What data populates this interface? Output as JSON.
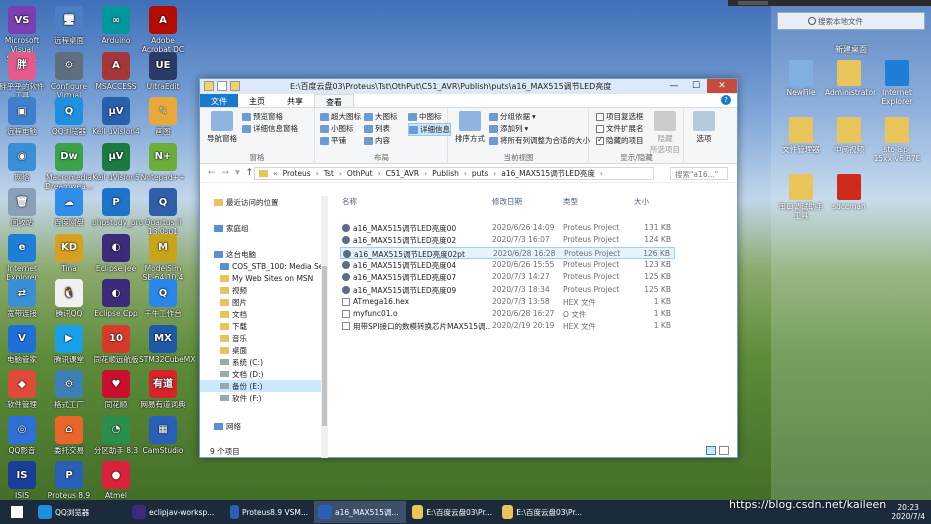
{
  "desktop_icons": [
    {
      "label": "Microsoft Visual Studio...",
      "color": "#7a3fb0",
      "glyph": "VS"
    },
    {
      "label": "远程桌面",
      "color": "#4c7fc4",
      "glyph": "🖥"
    },
    {
      "label": "Arduino",
      "color": "#00979d",
      "glyph": "∞"
    },
    {
      "label": "Adobe Acrobat DC",
      "color": "#b30b00",
      "glyph": "A"
    },
    {
      "label": "胖乎乎的软件工具",
      "color": "#e15b8c",
      "glyph": "胖"
    },
    {
      "label": "Configure Virtual Serial...",
      "color": "#5f6f80",
      "glyph": "⚙"
    },
    {
      "label": "MSACCESS",
      "color": "#a4373a",
      "glyph": "A"
    },
    {
      "label": "UltraEdit",
      "color": "#2b3a67",
      "glyph": "UE"
    },
    {
      "label": "远程电脑",
      "color": "#3f7fcf",
      "glyph": "▣"
    },
    {
      "label": "QQ浏览器",
      "color": "#1f8fe0",
      "glyph": "Q"
    },
    {
      "label": "Keil uVision4",
      "color": "#2a5fb0",
      "glyph": "µV"
    },
    {
      "label": "画图",
      "color": "#e9a93a",
      "glyph": "✎"
    },
    {
      "label": "网络",
      "color": "#3a8fd6",
      "glyph": "◉"
    },
    {
      "label": "Macromedia Dreamwea...",
      "color": "#3aa34a",
      "glyph": "Dw"
    },
    {
      "label": "Keil uVision5",
      "color": "#1a7a3f",
      "glyph": "µV"
    },
    {
      "label": "Notepad++",
      "color": "#6cae3a",
      "glyph": "N+"
    },
    {
      "label": "回收站",
      "color": "#8aa0b8",
      "glyph": "🗑"
    },
    {
      "label": "百度网盘",
      "color": "#2f8fe8",
      "glyph": "☁"
    },
    {
      "label": "phpstudy_pro",
      "color": "#1e72c8",
      "glyph": "P"
    },
    {
      "label": "Quartus II 13.0sp1 (64-...",
      "color": "#2f5fa8",
      "glyph": "Q"
    },
    {
      "label": "Internet Explorer",
      "color": "#1d7fd6",
      "glyph": "e"
    },
    {
      "label": "Tina",
      "color": "#d8a020",
      "glyph": "KD"
    },
    {
      "label": "Eclipse Jee",
      "color": "#3b2b7a",
      "glyph": "◐"
    },
    {
      "label": "ModelSim SE-64 10.4",
      "color": "#c7a41a",
      "glyph": "M"
    },
    {
      "label": "宽带连接",
      "color": "#3a8fd6",
      "glyph": "⇄"
    },
    {
      "label": "腾讯QQ",
      "color": "#f0f0f0",
      "glyph": "🐧"
    },
    {
      "label": "Eclipse Cpp",
      "color": "#3b2b7a",
      "glyph": "◐"
    },
    {
      "label": "千牛工作台",
      "color": "#2a86e8",
      "glyph": "Q"
    },
    {
      "label": "电脑管家",
      "color": "#1e6fd8",
      "glyph": "V"
    },
    {
      "label": "腾讯课堂",
      "color": "#19a0e8",
      "glyph": "▶"
    },
    {
      "label": "同花顺远航版",
      "color": "#d83a2a",
      "glyph": "10"
    },
    {
      "label": "STM32CubeMX",
      "color": "#1f5aa8",
      "glyph": "MX"
    },
    {
      "label": "软件管理",
      "color": "#e04a3a",
      "glyph": "◆"
    },
    {
      "label": "格式工厂",
      "color": "#3f7fb8",
      "glyph": "⚙"
    },
    {
      "label": "同花顺",
      "color": "#c8102e",
      "glyph": "♥"
    },
    {
      "label": "网易有道词典",
      "color": "#d8232a",
      "glyph": "有道"
    },
    {
      "label": "QQ影音",
      "color": "#2f6fd8",
      "glyph": "◎"
    },
    {
      "label": "委托交易",
      "color": "#e8662a",
      "glyph": "⌂"
    },
    {
      "label": "分区助手 8.3",
      "color": "#2a8f4a",
      "glyph": "◔"
    },
    {
      "label": "CamStudio",
      "color": "#2a5fb8",
      "glyph": "▦"
    },
    {
      "label": "ISIS",
      "color": "#1a3f9a",
      "glyph": "IS"
    },
    {
      "label": "Proteus 8.9 Professional",
      "color": "#2a5fb8",
      "glyph": "P"
    },
    {
      "label": "Atmel Studio 7.0",
      "color": "#d8233a",
      "glyph": "●"
    }
  ],
  "right_panel": {
    "search_placeholder": "搜索本地文件",
    "title": "新建桌面",
    "icons": [
      {
        "label": "NewFile",
        "color": "#7fb0e0"
      },
      {
        "label": "Administrator",
        "color": "#e9c45a"
      },
      {
        "label": "Internet Explorer",
        "color": "#1d7fd6"
      },
      {
        "label": "文件管理器",
        "color": "#e9c45a"
      },
      {
        "label": "中间视频",
        "color": "#e9c45a"
      },
      {
        "label": "stc-isp-15xx-v6.87E",
        "color": "#e9c45a"
      },
      {
        "label": "串口调试助手工具",
        "color": "#e9c45a"
      },
      {
        "label": "sdccman",
        "color": "#cc2a1a"
      }
    ]
  },
  "window": {
    "title": "E:\\百度云盘03\\Proteus\\Tst\\OthPut\\C51_AVR\\Publish\\puts\\a16_MAX515调节LED亮度",
    "controls": {
      "min": "—",
      "max": "☐",
      "close": "✕"
    },
    "tabs": [
      "文件",
      "主页",
      "共享",
      "查看"
    ],
    "help": "?",
    "ribbon": {
      "pane_group": {
        "label": "窗格",
        "nav_pane": "导航窗格",
        "preview": "预览窗格",
        "details": "详细信息窗格"
      },
      "layout_group": {
        "label": "布局",
        "items": [
          "超大图标",
          "大图标",
          "中图标",
          "小图标",
          "列表",
          "详细信息",
          "平铺",
          "内容"
        ]
      },
      "view_group": {
        "label": "当前视图",
        "sort": "排序方式",
        "group_by": "分组依据",
        "add_col": "添加列",
        "fit_cols": "将所有列调整为合适的大小"
      },
      "show_group": {
        "label": "显示/隐藏",
        "item_checkbox": "项目复选框",
        "extensions": "文件扩展名",
        "hidden": "隐藏的项目",
        "hide_selected": "隐藏",
        "hide_selected2": "所选项目"
      },
      "options": "选项"
    },
    "address": {
      "crumbs": [
        "Proteus",
        "Tst",
        "OthPut",
        "C51_AVR",
        "Publish",
        "puts",
        "a16_MAX515调节LED亮度"
      ],
      "search_placeholder": "搜索\"a16...\""
    },
    "nav_pane": [
      {
        "label": "最近访问的位置",
        "type": "star"
      },
      {
        "label": "家庭组",
        "type": "home"
      },
      {
        "label": "这台电脑",
        "type": "pc"
      },
      {
        "label": "COS_STB_100: Media Serv",
        "type": "media"
      },
      {
        "label": "My Web Sites on MSN",
        "type": "folder"
      },
      {
        "label": "视频",
        "type": "folder"
      },
      {
        "label": "图片",
        "type": "folder"
      },
      {
        "label": "文档",
        "type": "folder"
      },
      {
        "label": "下载",
        "type": "folder"
      },
      {
        "label": "音乐",
        "type": "folder"
      },
      {
        "label": "桌面",
        "type": "folder"
      },
      {
        "label": "系统 (C:)",
        "type": "drive"
      },
      {
        "label": "文档 (D:)",
        "type": "drive"
      },
      {
        "label": "备份 (E:)",
        "type": "drive",
        "selected": true
      },
      {
        "label": "软件 (F:)",
        "type": "drive"
      },
      {
        "label": "网络",
        "type": "net"
      }
    ],
    "columns": {
      "name": "名称",
      "date": "修改日期",
      "type": "类型",
      "size": "大小"
    },
    "files": [
      {
        "name": "a16_MAX515调节LED亮度00",
        "date": "2020/6/26 14:09",
        "type": "Proteus Project",
        "size": "131 KB",
        "icon": "proteus"
      },
      {
        "name": "a16_MAX515调节LED亮度02",
        "date": "2020/7/3 16:07",
        "type": "Proteus Project",
        "size": "124 KB",
        "icon": "proteus"
      },
      {
        "name": "a16_MAX515调节LED亮度02pt",
        "date": "2020/6/28 16:28",
        "type": "Proteus Project",
        "size": "126 KB",
        "icon": "proteus",
        "selected": true
      },
      {
        "name": "a16_MAX515调节LED亮度04",
        "date": "2020/6/26 15:55",
        "type": "Proteus Project",
        "size": "123 KB",
        "icon": "proteus"
      },
      {
        "name": "a16_MAX515调节LED亮度07",
        "date": "2020/7/3 14:27",
        "type": "Proteus Project",
        "size": "125 KB",
        "icon": "proteus"
      },
      {
        "name": "a16_MAX515调节LED亮度09",
        "date": "2020/7/3 18:34",
        "type": "Proteus Project",
        "size": "125 KB",
        "icon": "proteus"
      },
      {
        "name": "ATmega16.hex",
        "date": "2020/7/3 13:58",
        "type": "HEX 文件",
        "size": "1 KB",
        "icon": "doc"
      },
      {
        "name": "myfunc01.o",
        "date": "2020/6/28 16:27",
        "type": "O 文件",
        "size": "1 KB",
        "icon": "doc"
      },
      {
        "name": "用带SPI接口的数模转换芯片MAX515调...",
        "date": "2020/2/19 20:19",
        "type": "HEX 文件",
        "size": "1 KB",
        "icon": "doc"
      }
    ],
    "status": "9 个项目"
  },
  "taskbar": [
    {
      "label": "QQ浏览器",
      "color": "#1f8fe0"
    },
    {
      "label": "eclipjav-worksp...",
      "color": "#3b2b7a"
    },
    {
      "label": "Proteus8.9 VSM...",
      "color": "#2a5fb8"
    },
    {
      "label": "a16_MAX515调...",
      "color": "#2a5fb8"
    },
    {
      "label": "E:\\百度云盘03\\Pr...",
      "color": "#e9c45a"
    },
    {
      "label": "E:\\百度云盘03\\Pr...",
      "color": "#e9c45a"
    }
  ],
  "clock": {
    "time": "20:23",
    "date": "2020/7/4"
  },
  "watermark": "https://blog.csdn.net/kaileen"
}
